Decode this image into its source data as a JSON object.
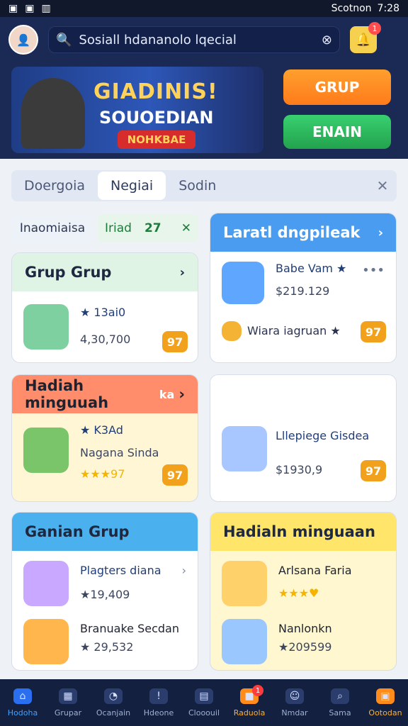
{
  "status": {
    "left": [
      "▣",
      "▣",
      "▥"
    ],
    "right_text": "Scotnon",
    "time": "7:28"
  },
  "header": {
    "search_placeholder": "Sosiall hdananolo lqecial",
    "notif_badge": "1"
  },
  "banner": {
    "title": "GIADINIS!",
    "subtitle": "SOUOEDIAN",
    "tag": "NOHKBAE",
    "button_primary": "GRUP",
    "button_secondary": "ENAIN"
  },
  "tabs": [
    "Doergoia",
    "Negiai",
    "Sodin"
  ],
  "filters": {
    "chip_left": "Inaomiaisa",
    "chip_right_label": "Iriad",
    "chip_right_count": "27"
  },
  "cards": {
    "left1": {
      "title": "Grup Grup",
      "row_title": "★ 13ai0",
      "row_sub": "4,30,700",
      "pill": "97"
    },
    "right1": {
      "title": "Laratl dngpileak",
      "row1_title": "Babe Vam ★",
      "row1_sub": "$219.129",
      "row2_title": "Wiara iagruan ★",
      "pill": "97"
    },
    "left2": {
      "title": "Hadiah minguuah",
      "tag": "ka",
      "row_title": "★ K3Ad",
      "row_sub": "Nagana Sinda",
      "row_sub2": "★★★97",
      "pill": "97"
    },
    "right2": {
      "row_title": "Lllepiege Gisdea",
      "row_sub": "$1930,9",
      "pill": "97"
    },
    "left3": {
      "title": "Ganian Grup",
      "row1_title": "Plagters diana",
      "row1_sub": "★19,409",
      "row2_title": "Branuake Secdan",
      "row2_sub": "★ 29,532"
    },
    "right3": {
      "title": "Hadialn minguaan",
      "row1_title": "Arlsana Faria",
      "row1_sub": "★★★♥",
      "row2_title": "Nanlonkn",
      "row2_sub": "★209599"
    }
  },
  "nav": [
    {
      "label": "Hodoha"
    },
    {
      "label": "Grupar"
    },
    {
      "label": "Ocanjain"
    },
    {
      "label": "Hdeone"
    },
    {
      "label": "Clooouil"
    },
    {
      "label": "Raduola",
      "badge": "1"
    },
    {
      "label": "Nmdar"
    },
    {
      "label": "Sama"
    },
    {
      "label": "Ootodan"
    }
  ],
  "colors": {
    "primary": "#1a2a55",
    "accent_orange": "#ff8c1a",
    "accent_green": "#23a24d"
  }
}
